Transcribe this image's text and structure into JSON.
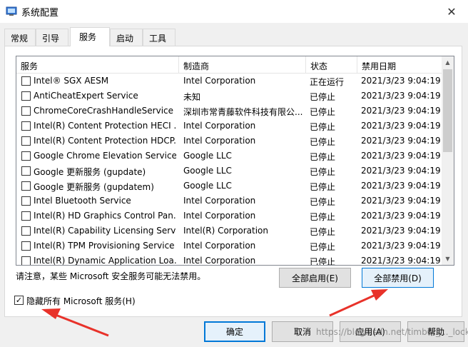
{
  "window": {
    "title": "系统配置"
  },
  "tabs": [
    {
      "label": "常规"
    },
    {
      "label": "引导"
    },
    {
      "label": "服务"
    },
    {
      "label": "启动"
    },
    {
      "label": "工具"
    }
  ],
  "columns": [
    "服务",
    "制造商",
    "状态",
    "禁用日期"
  ],
  "services": [
    {
      "name": "Intel® SGX AESM",
      "maker": "Intel Corporation",
      "status": "正在运行",
      "date": "2021/3/23 9:04:19"
    },
    {
      "name": "AntiCheatExpert Service",
      "maker": "未知",
      "status": "已停止",
      "date": "2021/3/23 9:04:19"
    },
    {
      "name": "ChromeCoreCrashHandleService",
      "maker": "深圳市常青藤软件科技有限公...",
      "status": "已停止",
      "date": "2021/3/23 9:04:19"
    },
    {
      "name": "Intel(R) Content Protection HECI ...",
      "maker": "Intel Corporation",
      "status": "已停止",
      "date": "2021/3/23 9:04:19"
    },
    {
      "name": "Intel(R) Content Protection HDCP...",
      "maker": "Intel Corporation",
      "status": "已停止",
      "date": "2021/3/23 9:04:19"
    },
    {
      "name": "Google Chrome Elevation Service",
      "maker": "Google LLC",
      "status": "已停止",
      "date": "2021/3/23 9:04:19"
    },
    {
      "name": "Google 更新服务 (gupdate)",
      "maker": "Google LLC",
      "status": "已停止",
      "date": "2021/3/23 9:04:19"
    },
    {
      "name": "Google 更新服务 (gupdatem)",
      "maker": "Google LLC",
      "status": "已停止",
      "date": "2021/3/23 9:04:19"
    },
    {
      "name": "Intel Bluetooth Service",
      "maker": "Intel Corporation",
      "status": "已停止",
      "date": "2021/3/23 9:04:19"
    },
    {
      "name": "Intel(R) HD Graphics Control Pan...",
      "maker": "Intel Corporation",
      "status": "已停止",
      "date": "2021/3/23 9:04:19"
    },
    {
      "name": "Intel(R) Capability Licensing Servi...",
      "maker": "Intel(R) Corporation",
      "status": "已停止",
      "date": "2021/3/23 9:04:19"
    },
    {
      "name": "Intel(R) TPM Provisioning Service",
      "maker": "Intel Corporation",
      "status": "已停止",
      "date": "2021/3/23 9:04:19"
    },
    {
      "name": "Intel(R) Dynamic Application Loa...",
      "maker": "Intel Corporation",
      "status": "已停止",
      "date": "2021/3/23 9:04:19"
    }
  ],
  "note": "请注意，某些 Microsoft 安全服务可能无法禁用。",
  "buttons": {
    "enable_all": "全部启用(E)",
    "disable_all": "全部禁用(D)",
    "ok": "确定",
    "cancel": "取消",
    "apply": "应用(A)",
    "help": "帮助"
  },
  "hide_ms": {
    "label": "隐藏所有 Microsoft 服务(H)",
    "checked": true
  },
  "watermark": "https://blog.csdn.net/timber_..._lock",
  "colors": {
    "accent": "#0078d7",
    "arrow": "#e8322a"
  },
  "icons": {
    "app": "system-config-icon",
    "close": "close-icon",
    "scroll_up": "chevron-up-icon",
    "scroll_down": "chevron-down-icon"
  }
}
